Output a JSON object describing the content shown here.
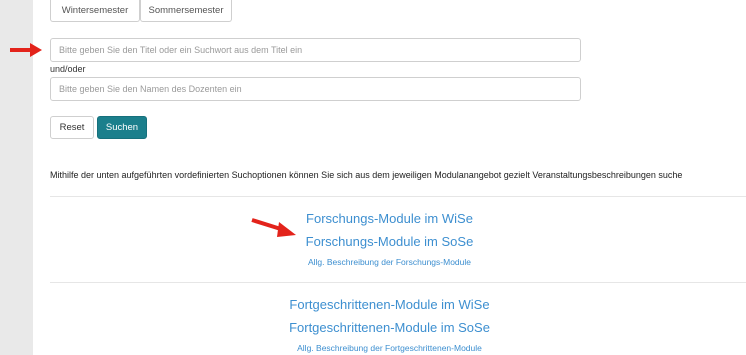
{
  "semester_tabs": {
    "winter": "Wintersemester",
    "summer": "Sommersemester"
  },
  "search": {
    "title_placeholder": "Bitte geben Sie den Titel oder ein Suchwort aus dem Titel ein",
    "and_or": "und/oder",
    "lecturer_placeholder": "Bitte geben Sie den Namen des Dozenten ein",
    "reset_label": "Reset",
    "submit_label": "Suchen"
  },
  "info_text": "Mithilfe der unten aufgeführten vordefinierten Suchoptionen können Sie sich aus dem jeweiligen Modulanangebot gezielt Veranstaltungsbeschreibungen suche",
  "module_groups": [
    {
      "ws_link": "Forschungs-Module im WiSe",
      "ss_link": "Forschungs-Module im SoSe",
      "description": "Allg. Beschreibung der Forschungs-Module"
    },
    {
      "ws_link": "Fortgeschrittenen-Module im WiSe",
      "ss_link": "Fortgeschrittenen-Module im SoSe",
      "description": "Allg. Beschreibung der Fortgeschrittenen-Module"
    }
  ],
  "colors": {
    "accent": "#1b7f8c",
    "link": "#3d8fd0",
    "arrow": "#e3231b"
  }
}
